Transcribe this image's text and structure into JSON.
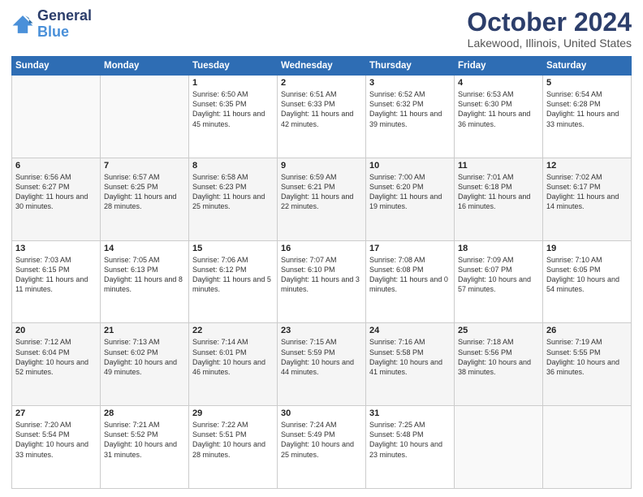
{
  "logo": {
    "line1": "General",
    "line2": "Blue"
  },
  "header": {
    "month": "October 2024",
    "location": "Lakewood, Illinois, United States"
  },
  "weekdays": [
    "Sunday",
    "Monday",
    "Tuesday",
    "Wednesday",
    "Thursday",
    "Friday",
    "Saturday"
  ],
  "weeks": [
    [
      {
        "day": "",
        "text": ""
      },
      {
        "day": "",
        "text": ""
      },
      {
        "day": "1",
        "text": "Sunrise: 6:50 AM\nSunset: 6:35 PM\nDaylight: 11 hours and 45 minutes."
      },
      {
        "day": "2",
        "text": "Sunrise: 6:51 AM\nSunset: 6:33 PM\nDaylight: 11 hours and 42 minutes."
      },
      {
        "day": "3",
        "text": "Sunrise: 6:52 AM\nSunset: 6:32 PM\nDaylight: 11 hours and 39 minutes."
      },
      {
        "day": "4",
        "text": "Sunrise: 6:53 AM\nSunset: 6:30 PM\nDaylight: 11 hours and 36 minutes."
      },
      {
        "day": "5",
        "text": "Sunrise: 6:54 AM\nSunset: 6:28 PM\nDaylight: 11 hours and 33 minutes."
      }
    ],
    [
      {
        "day": "6",
        "text": "Sunrise: 6:56 AM\nSunset: 6:27 PM\nDaylight: 11 hours and 30 minutes."
      },
      {
        "day": "7",
        "text": "Sunrise: 6:57 AM\nSunset: 6:25 PM\nDaylight: 11 hours and 28 minutes."
      },
      {
        "day": "8",
        "text": "Sunrise: 6:58 AM\nSunset: 6:23 PM\nDaylight: 11 hours and 25 minutes."
      },
      {
        "day": "9",
        "text": "Sunrise: 6:59 AM\nSunset: 6:21 PM\nDaylight: 11 hours and 22 minutes."
      },
      {
        "day": "10",
        "text": "Sunrise: 7:00 AM\nSunset: 6:20 PM\nDaylight: 11 hours and 19 minutes."
      },
      {
        "day": "11",
        "text": "Sunrise: 7:01 AM\nSunset: 6:18 PM\nDaylight: 11 hours and 16 minutes."
      },
      {
        "day": "12",
        "text": "Sunrise: 7:02 AM\nSunset: 6:17 PM\nDaylight: 11 hours and 14 minutes."
      }
    ],
    [
      {
        "day": "13",
        "text": "Sunrise: 7:03 AM\nSunset: 6:15 PM\nDaylight: 11 hours and 11 minutes."
      },
      {
        "day": "14",
        "text": "Sunrise: 7:05 AM\nSunset: 6:13 PM\nDaylight: 11 hours and 8 minutes."
      },
      {
        "day": "15",
        "text": "Sunrise: 7:06 AM\nSunset: 6:12 PM\nDaylight: 11 hours and 5 minutes."
      },
      {
        "day": "16",
        "text": "Sunrise: 7:07 AM\nSunset: 6:10 PM\nDaylight: 11 hours and 3 minutes."
      },
      {
        "day": "17",
        "text": "Sunrise: 7:08 AM\nSunset: 6:08 PM\nDaylight: 11 hours and 0 minutes."
      },
      {
        "day": "18",
        "text": "Sunrise: 7:09 AM\nSunset: 6:07 PM\nDaylight: 10 hours and 57 minutes."
      },
      {
        "day": "19",
        "text": "Sunrise: 7:10 AM\nSunset: 6:05 PM\nDaylight: 10 hours and 54 minutes."
      }
    ],
    [
      {
        "day": "20",
        "text": "Sunrise: 7:12 AM\nSunset: 6:04 PM\nDaylight: 10 hours and 52 minutes."
      },
      {
        "day": "21",
        "text": "Sunrise: 7:13 AM\nSunset: 6:02 PM\nDaylight: 10 hours and 49 minutes."
      },
      {
        "day": "22",
        "text": "Sunrise: 7:14 AM\nSunset: 6:01 PM\nDaylight: 10 hours and 46 minutes."
      },
      {
        "day": "23",
        "text": "Sunrise: 7:15 AM\nSunset: 5:59 PM\nDaylight: 10 hours and 44 minutes."
      },
      {
        "day": "24",
        "text": "Sunrise: 7:16 AM\nSunset: 5:58 PM\nDaylight: 10 hours and 41 minutes."
      },
      {
        "day": "25",
        "text": "Sunrise: 7:18 AM\nSunset: 5:56 PM\nDaylight: 10 hours and 38 minutes."
      },
      {
        "day": "26",
        "text": "Sunrise: 7:19 AM\nSunset: 5:55 PM\nDaylight: 10 hours and 36 minutes."
      }
    ],
    [
      {
        "day": "27",
        "text": "Sunrise: 7:20 AM\nSunset: 5:54 PM\nDaylight: 10 hours and 33 minutes."
      },
      {
        "day": "28",
        "text": "Sunrise: 7:21 AM\nSunset: 5:52 PM\nDaylight: 10 hours and 31 minutes."
      },
      {
        "day": "29",
        "text": "Sunrise: 7:22 AM\nSunset: 5:51 PM\nDaylight: 10 hours and 28 minutes."
      },
      {
        "day": "30",
        "text": "Sunrise: 7:24 AM\nSunset: 5:49 PM\nDaylight: 10 hours and 25 minutes."
      },
      {
        "day": "31",
        "text": "Sunrise: 7:25 AM\nSunset: 5:48 PM\nDaylight: 10 hours and 23 minutes."
      },
      {
        "day": "",
        "text": ""
      },
      {
        "day": "",
        "text": ""
      }
    ]
  ]
}
